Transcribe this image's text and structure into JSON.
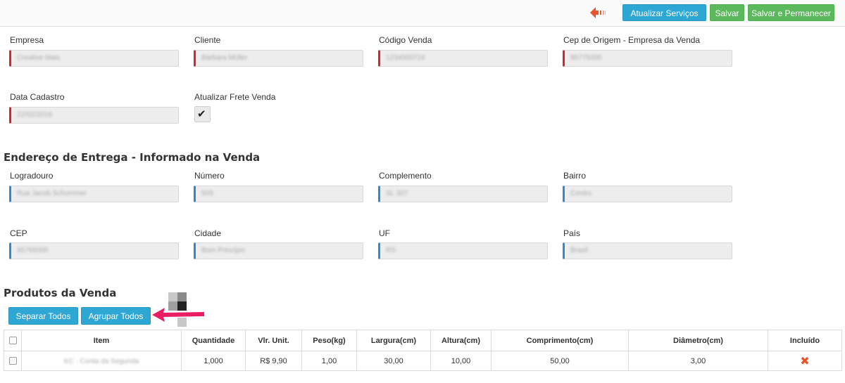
{
  "toolbar": {
    "back_icon": "back-arrow-icon",
    "atualizar_label": "Atualizar Serviços",
    "salvar_label": "Salvar",
    "salvar_perm_label": "Salvar e Permanecer",
    "colors": {
      "info": "#2ea7d4",
      "success": "#5cb85c",
      "back_arrow": "#e8542b"
    }
  },
  "general": {
    "empresa": {
      "label": "Empresa",
      "value": "Creative Mais"
    },
    "cliente": {
      "label": "Cliente",
      "value": "Bárbara Müller"
    },
    "codigo": {
      "label": "Código Venda",
      "value": "1234500724"
    },
    "cep_origem": {
      "label": "Cep de Origem - Empresa da Venda",
      "value": "95775000"
    },
    "data_cadastro": {
      "label": "Data Cadastro",
      "value": "22/02/2016"
    },
    "atualizar_frete": {
      "label": "Atualizar Frete Venda",
      "checked": true,
      "check_mark": "✔"
    }
  },
  "address": {
    "title": "Endereço de Entrega - Informado na Venda",
    "logradouro": {
      "label": "Logradouro",
      "value": "Rua Jacob Schommer"
    },
    "numero": {
      "label": "Número",
      "value": "509"
    },
    "complemento": {
      "label": "Complemento",
      "value": "SL 307"
    },
    "bairro": {
      "label": "Bairro",
      "value": "Centro"
    },
    "cep": {
      "label": "CEP",
      "value": "95765000"
    },
    "cidade": {
      "label": "Cidade",
      "value": "Bom Princípio"
    },
    "uf": {
      "label": "UF",
      "value": "RS"
    },
    "pais": {
      "label": "País",
      "value": "Brasil"
    }
  },
  "products": {
    "title": "Produtos da Venda",
    "separar_label": "Separar Todos",
    "agrupar_label": "Agrupar Todos",
    "columns": [
      "Item",
      "Quantidade",
      "Vlr. Unit.",
      "Peso(kg)",
      "Largura(cm)",
      "Altura(cm)",
      "Comprimento(cm)",
      "Diâmetro(cm)",
      "Incluído"
    ],
    "rows": [
      {
        "item": "KC - Conta da Segunda",
        "quantidade": "1,000",
        "vlr_unit": "R$ 9,90",
        "peso": "1,00",
        "largura": "30,00",
        "altura": "10,00",
        "comprimento": "50,00",
        "diametro": "3,00",
        "incluido_icon": "close-icon",
        "incluido_glyph": "✖"
      }
    ]
  }
}
